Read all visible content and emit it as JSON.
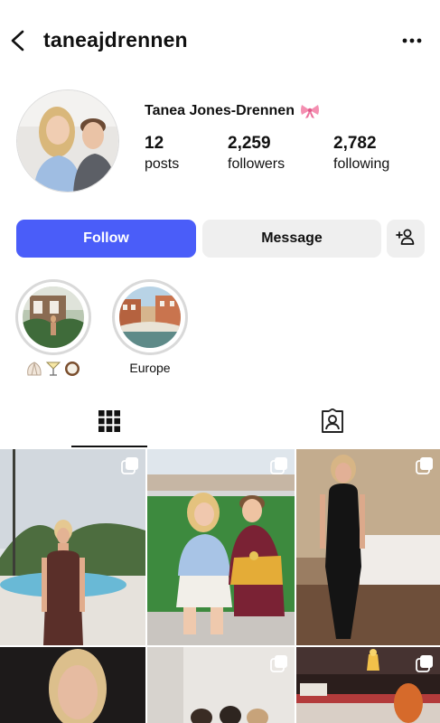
{
  "header": {
    "username": "taneajdrennen",
    "back_icon": "chevron-left-icon",
    "more_icon": "more-horizontal-icon"
  },
  "profile": {
    "full_name": "Tanea Jones-Drennen",
    "name_emoji_icon": "ribbon-bow-icon",
    "stats": [
      {
        "value": "12",
        "label": "posts"
      },
      {
        "value": "2,259",
        "label": "followers"
      },
      {
        "value": "2,782",
        "label": "following"
      }
    ]
  },
  "actions": {
    "follow_label": "Follow",
    "message_label": "Message",
    "add_user_icon": "add-person-icon"
  },
  "highlights": [
    {
      "label_emojis": [
        "shell-icon",
        "cocktail-icon",
        "coconut-icon"
      ],
      "label": ""
    },
    {
      "label": "Europe"
    }
  ],
  "tabs": {
    "grid_icon": "grid-icon",
    "tagged_icon": "tagged-person-icon",
    "active": "grid"
  },
  "colors": {
    "follow_button": "#4a5df9",
    "secondary_button": "#efefef",
    "ring": "#d9d9d9"
  },
  "posts": [
    {
      "multi": true
    },
    {
      "multi": true
    },
    {
      "multi": true
    },
    {
      "multi": false
    },
    {
      "multi": true
    },
    {
      "multi": true
    }
  ]
}
